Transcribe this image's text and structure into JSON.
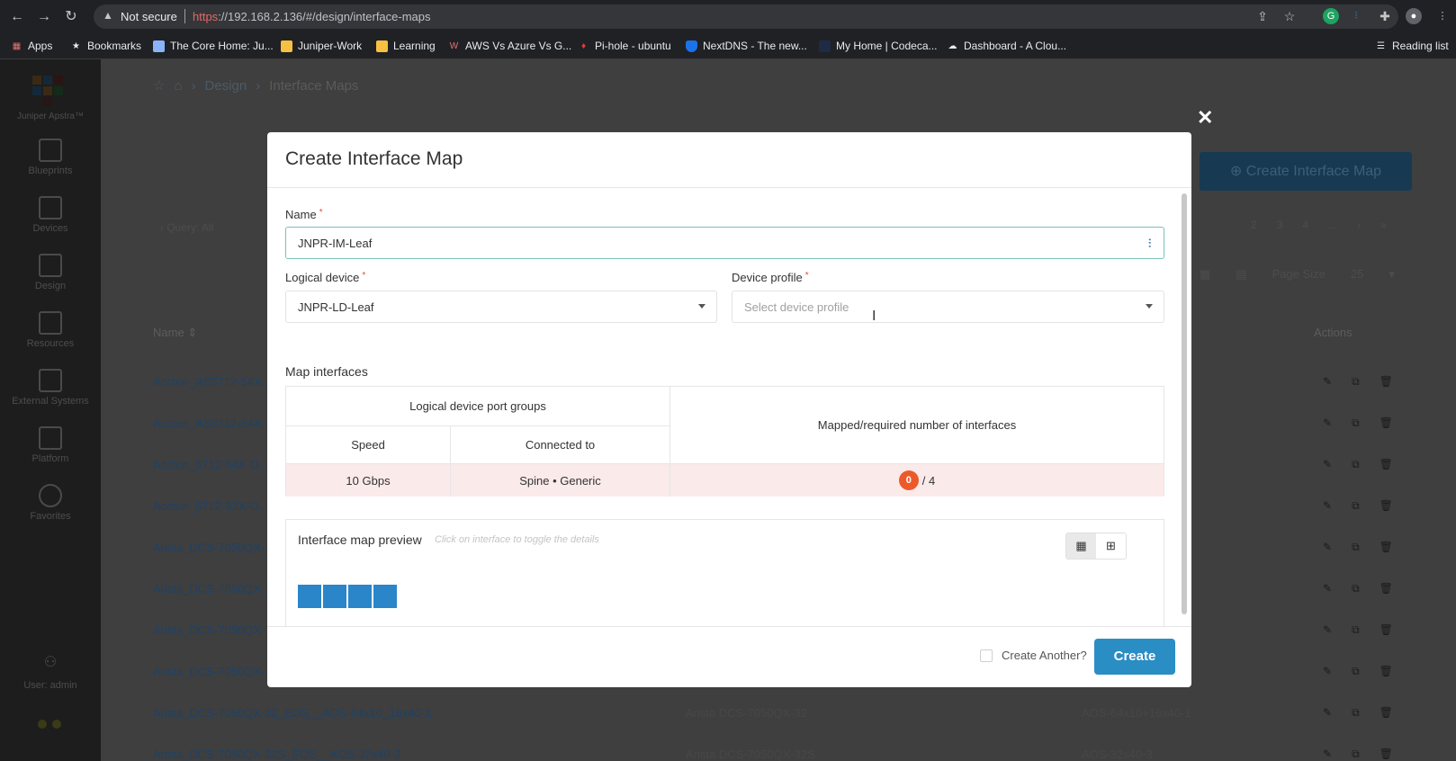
{
  "browser": {
    "security_label": "Not secure",
    "url_scheme": "https",
    "url_rest": "://192.168.2.136/#/design/interface-maps",
    "bookmarks": [
      {
        "label": "Apps",
        "icon": "apps-grid-icon"
      },
      {
        "label": "Bookmarks",
        "icon": "star-icon"
      },
      {
        "label": "The Core Home: Ju...",
        "icon": "site-favicon"
      },
      {
        "label": "Juniper-Work",
        "icon": "folder-icon"
      },
      {
        "label": "Learning",
        "icon": "folder-icon"
      },
      {
        "label": "AWS Vs Azure Vs G...",
        "icon": "site-favicon"
      },
      {
        "label": "Pi-hole - ubuntu",
        "icon": "site-favicon"
      },
      {
        "label": "NextDNS - The new...",
        "icon": "shield-favicon"
      },
      {
        "label": "My Home | Codeca...",
        "icon": "site-favicon"
      },
      {
        "label": "Dashboard - A Clou...",
        "icon": "cloud-favicon"
      }
    ],
    "reading_list": "Reading list"
  },
  "app": {
    "brand": "Juniper Apstra™",
    "sidebar": [
      {
        "label": "Blueprints"
      },
      {
        "label": "Devices"
      },
      {
        "label": "Design"
      },
      {
        "label": "Resources"
      },
      {
        "label": "External Systems"
      },
      {
        "label": "Platform"
      },
      {
        "label": "Favorites"
      }
    ],
    "user": "User: admin",
    "breadcrumb": {
      "section": "Design",
      "current": "Interface Maps"
    },
    "create_button": "Create Interface Map",
    "query": "Query: All",
    "pager": [
      "2",
      "3",
      "4",
      "...",
      "›",
      "»"
    ],
    "page_size_label": "Page Size",
    "page_size_value": "25",
    "table_headers": {
      "name": "Name",
      "actions": "Actions"
    },
    "rows": [
      "Accton_AS5712-54X...",
      "Accton_AS5712-54X...",
      "Accton_5712-54X-O...",
      "Accton_6712-32X-O...",
      "Arista_DCS-7050QX-...",
      "Arista_DCS-7050QX-...",
      "Arista_DCS-7050QX-...",
      "Arista_DCS-7050QX-...",
      "Arista_DCS-7050QX-32_EOS__AOS-64x10_16x40-1",
      "Arista_DCS-7050QX-32S_EOS__AOS-32x40-3"
    ],
    "row_device_profiles": {
      "8": "Arista DCS-7050QX-32",
      "9": "Arista DCS-7050QX-32S"
    },
    "row_logical_devices": {
      "8": "AOS-64x10+16x40-1",
      "9": "AOS-32x40-3"
    }
  },
  "modal": {
    "title": "Create Interface Map",
    "name_label": "Name",
    "name_value": "JNPR-IM-Leaf",
    "logical_device_label": "Logical device",
    "logical_device_value": "JNPR-LD-Leaf",
    "device_profile_label": "Device profile",
    "device_profile_placeholder": "Select device profile",
    "map_interfaces_title": "Map interfaces",
    "table": {
      "group_header": "Logical device port groups",
      "mapped_header": "Mapped/required number of interfaces",
      "speed_header": "Speed",
      "connected_header": "Connected to",
      "rows": [
        {
          "speed": "10 Gbps",
          "connected_to": "Spine • Generic",
          "mapped": "0",
          "required": "/ 4"
        }
      ]
    },
    "preview_title": "Interface map preview",
    "preview_hint": "Click on interface to toggle the details",
    "port_count": 4,
    "create_another_label": "Create Another?",
    "create_button": "Create"
  },
  "colors": {
    "accent": "#2a8dc4",
    "port": "#2a86c9",
    "badge": "#ec5a2b",
    "error_row": "#fbeaea"
  }
}
